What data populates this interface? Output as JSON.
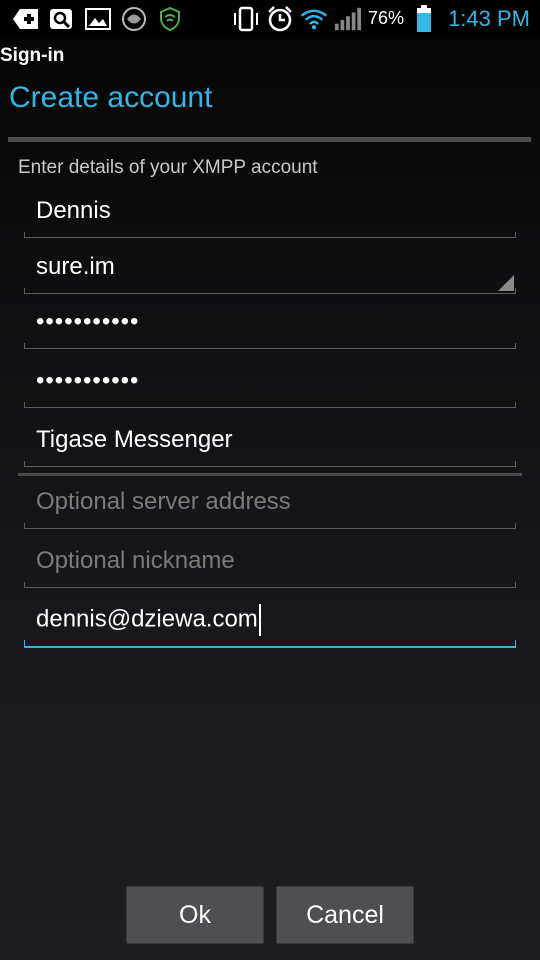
{
  "status_bar": {
    "battery_percent": "76%",
    "time": "1:43 PM",
    "colors": {
      "time": "#33b5e5",
      "wifi": "#33b5e5",
      "battery": "#33b5e5",
      "shield": "#4caf50"
    },
    "icons": [
      "add-notification-icon",
      "search-notification-icon",
      "image-notification-icon",
      "app-notification-icon",
      "shield-icon",
      "vibrate-icon",
      "alarm-icon",
      "wifi-icon",
      "signal-icon",
      "battery-icon"
    ]
  },
  "window": {
    "title": "Sign-in"
  },
  "dialog": {
    "title": "Create account",
    "subtitle": "Enter details of your XMPP account",
    "accent_color": "#33b5e5"
  },
  "form": {
    "username": {
      "value": "Dennis"
    },
    "domain": {
      "value": "sure.im"
    },
    "password": {
      "value": "•••••••••••"
    },
    "password_confirm": {
      "value": "•••••••••••"
    },
    "full_name": {
      "value": "Tigase Messenger"
    },
    "server": {
      "placeholder": "Optional server address"
    },
    "nickname": {
      "placeholder": "Optional nickname"
    },
    "email": {
      "value": "dennis@dziewa.com"
    }
  },
  "buttons": {
    "ok": "Ok",
    "cancel": "Cancel"
  }
}
